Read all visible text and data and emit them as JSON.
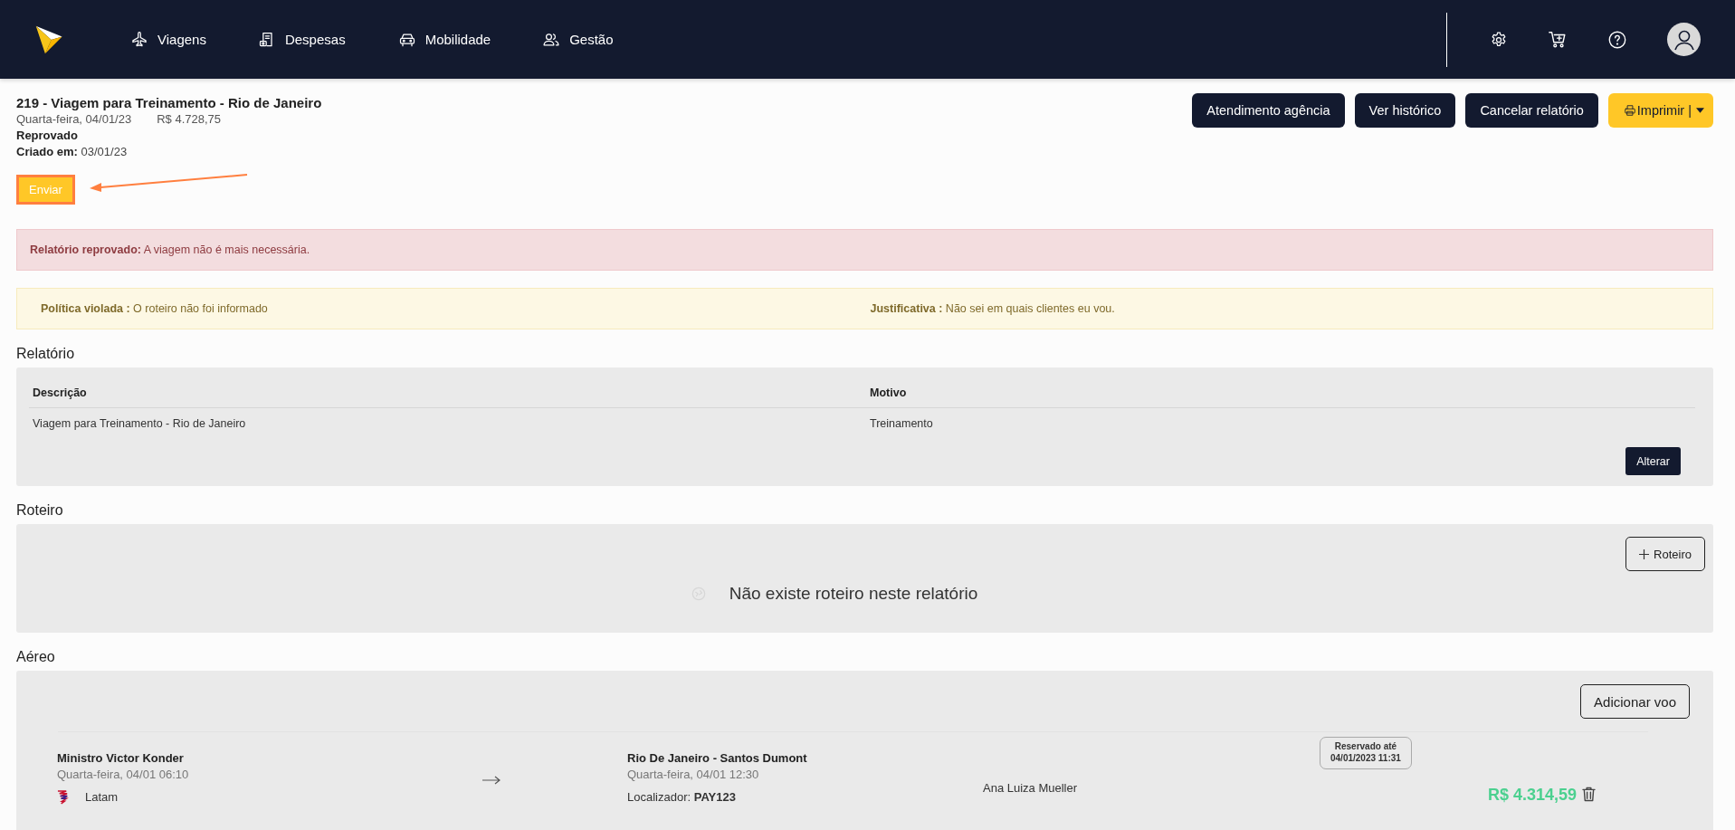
{
  "navbar": {
    "menu": [
      {
        "label": "Viagens"
      },
      {
        "label": "Despesas"
      },
      {
        "label": "Mobilidade"
      },
      {
        "label": "Gestão"
      }
    ]
  },
  "report": {
    "title": "219 - Viagem para Treinamento - Rio de Janeiro",
    "date": "Quarta-feira, 04/01/23",
    "amount": "R$ 4.728,75",
    "status": "Reprovado",
    "created": "**Criado em:** 03/01/23"
  },
  "actions": [
    {
      "label": "Atendimento agência",
      "kind": "dark"
    },
    {
      "label": "Ver histórico",
      "kind": "dark"
    },
    {
      "label": "Cancelar relatório",
      "kind": "dark"
    },
    {
      "label": "Imprimir |",
      "kind": "print"
    }
  ],
  "send_button": {
    "label": "Enviar",
    "highlighted": true
  },
  "alerts": [
    {
      "kind": "danger",
      "texts": [
        "**Relatório reprovado:** A viagem não é mais necessária."
      ]
    },
    {
      "kind": "warning",
      "texts": [
        "**Política violada :** O roteiro não foi informado",
        "**Justificativa :** Não sei em quais clientes eu vou."
      ]
    }
  ],
  "relatorio": {
    "heading": "Relatório",
    "columns": [
      "Descrição",
      "Motivo"
    ],
    "rows": [
      [
        "Viagem para Treinamento - Rio de Janeiro",
        "Treinamento"
      ]
    ],
    "button": "Alterar"
  },
  "roteiro": {
    "heading": "Roteiro",
    "add_button": "Roteiro",
    "empty_message": "Não existe roteiro neste relatório"
  },
  "aereo": {
    "heading": "Aéreo",
    "add_button": "Adicionar voo",
    "flights": [
      {
        "origin": "Ministro Victor Konder",
        "departure": "Quarta-feira, 04/01 06:10",
        "airline": "Latam",
        "destination": "Rio De Janeiro - Santos Dumont",
        "arrival": "Quarta-feira, 04/01 12:30",
        "locator": "Localizador: **PAY123**",
        "passenger": "Ana Luiza Mueller",
        "reservation_label": "Reservado até",
        "reservation_value": "04/01/2023 11:31",
        "price": "R$ 4.314,59"
      }
    ]
  }
}
